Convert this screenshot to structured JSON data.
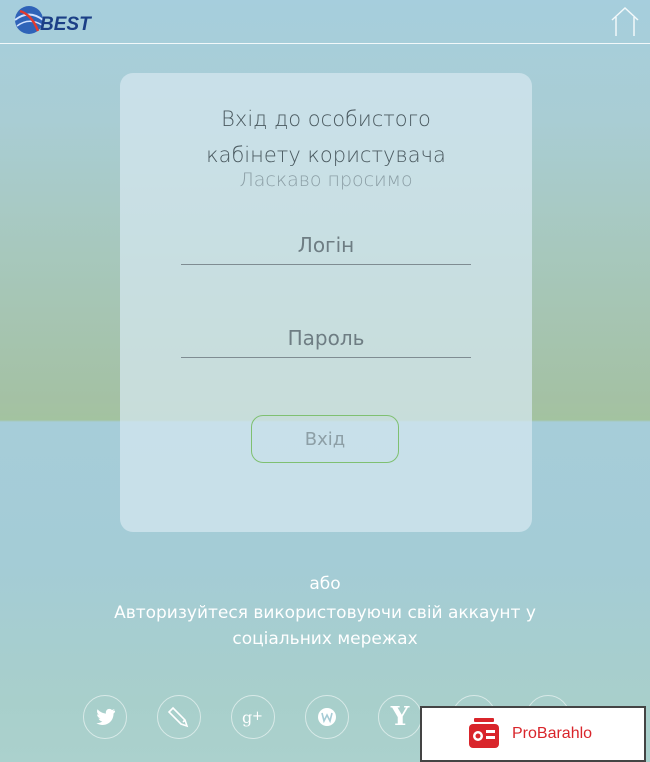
{
  "header": {
    "logo_text": "BEST",
    "home_icon": "home-icon"
  },
  "login": {
    "title": "Вхід до особистого кабінету користувача",
    "subtitle": "Ласкаво просимо",
    "login_placeholder": "Логін",
    "password_placeholder": "Пароль",
    "submit_label": "Вхід"
  },
  "social": {
    "or_text": "або",
    "prompt": "Авторизуйтеся використовуючи свій аккаунт у соціальних мережах",
    "providers": [
      "twitter-icon",
      "livejournal-icon",
      "google-plus-icon",
      "webmoney-icon",
      "yandex-icon",
      "mailru-icon",
      "facebook-icon"
    ],
    "yandex_glyph": "Y"
  },
  "ad": {
    "text": "ProBarahlo",
    "color": "#d9252b"
  },
  "colors": {
    "accent_border": "#7fc071",
    "logo_blue": "#1b3f86"
  }
}
